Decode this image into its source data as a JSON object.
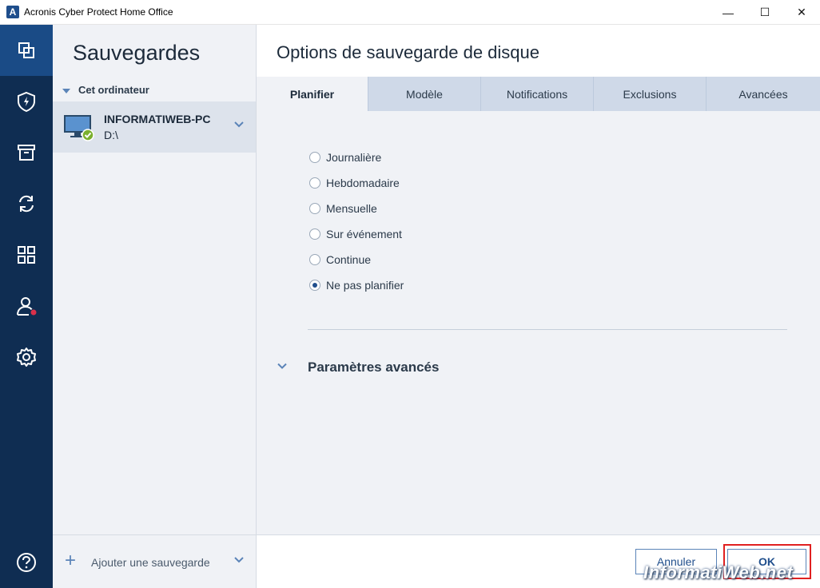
{
  "window": {
    "logo_letter": "A",
    "title": "Acronis Cyber Protect Home Office",
    "minimize": "—",
    "maximize": "☐",
    "close": "✕"
  },
  "nav": {
    "items": [
      {
        "name": "backups",
        "icon": "copy-icon",
        "active": true
      },
      {
        "name": "protection",
        "icon": "shield-bolt-icon"
      },
      {
        "name": "archive",
        "icon": "archive-box-icon"
      },
      {
        "name": "sync",
        "icon": "sync-icon"
      },
      {
        "name": "tools",
        "icon": "grid-icon"
      },
      {
        "name": "account",
        "icon": "user-icon",
        "badge_color": "#d9304a"
      },
      {
        "name": "settings",
        "icon": "gear-icon"
      },
      {
        "name": "help",
        "icon": "help-icon"
      }
    ]
  },
  "backups_panel": {
    "title": "Sauvegardes",
    "group_label": "Cet ordinateur",
    "item": {
      "name": "INFORMATIWEB-PC",
      "sub": "D:\\",
      "icon": "computer-icon",
      "status_icon": "check-circle-icon",
      "status_color": "#7bb02f"
    },
    "add_label": "Ajouter une sauvegarde"
  },
  "main": {
    "title": "Options de sauvegarde de disque",
    "tabs": [
      {
        "label": "Planifier",
        "active": true
      },
      {
        "label": "Modèle"
      },
      {
        "label": "Notifications"
      },
      {
        "label": "Exclusions"
      },
      {
        "label": "Avancées"
      }
    ],
    "schedule_options": [
      {
        "label": "Journalière",
        "checked": false
      },
      {
        "label": "Hebdomadaire",
        "checked": false
      },
      {
        "label": "Mensuelle",
        "checked": false
      },
      {
        "label": "Sur événement",
        "checked": false
      },
      {
        "label": "Continue",
        "checked": false
      },
      {
        "label": "Ne pas planifier",
        "checked": true
      }
    ],
    "advanced_label": "Paramètres avancés",
    "buttons": {
      "cancel": "Annuler",
      "ok": "OK"
    },
    "watermark": "InformatiWeb.net"
  },
  "colors": {
    "nav_bg": "#0f2d52",
    "nav_active": "#1a4b86",
    "accent": "#1f4e8c",
    "highlight": "#e02020"
  }
}
